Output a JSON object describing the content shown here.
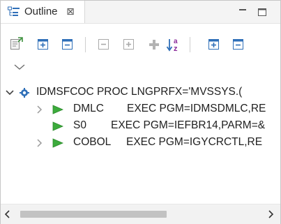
{
  "view": {
    "title": "Outline",
    "close_glyph": "⊠",
    "tab_icon": "outline-view-icon",
    "minimize_icon": "minimize-icon",
    "maximize_icon": "maximize-icon"
  },
  "toolbar": {
    "buttons": [
      "link-with-editor-icon",
      "expand-all-icon",
      "collapse-all-icon",
      "collapse-disabled-icon",
      "expand-disabled-icon",
      "add-disabled-icon",
      "sort-alphabetically-icon",
      "expand-icon",
      "collapse-icon"
    ],
    "menu_icon": "view-menu-chevron-icon"
  },
  "tree": {
    "root": {
      "text": "IDMSFCOC PROC LNGPRFX='MVSSYS.(",
      "expanded": true,
      "icon": "proc-gear-icon"
    },
    "children": [
      {
        "step": "DMLC",
        "exec": "EXEC PGM=IDMSDMLC,RE",
        "has_children": true,
        "icon": "exec-step-icon"
      },
      {
        "step": "S0",
        "exec": "EXEC PGM=IEFBR14,PARM=&",
        "has_children": false,
        "icon": "exec-step-icon"
      },
      {
        "step": "COBOL",
        "exec": "EXEC PGM=IGYCRCTL,RE",
        "has_children": true,
        "icon": "exec-step-icon"
      }
    ]
  },
  "colors": {
    "step_icon": "#3cab3c",
    "icon_blue": "#2f6fb8",
    "disabled": "#a9a9a9",
    "sort_purple": "#8a2a9a"
  }
}
